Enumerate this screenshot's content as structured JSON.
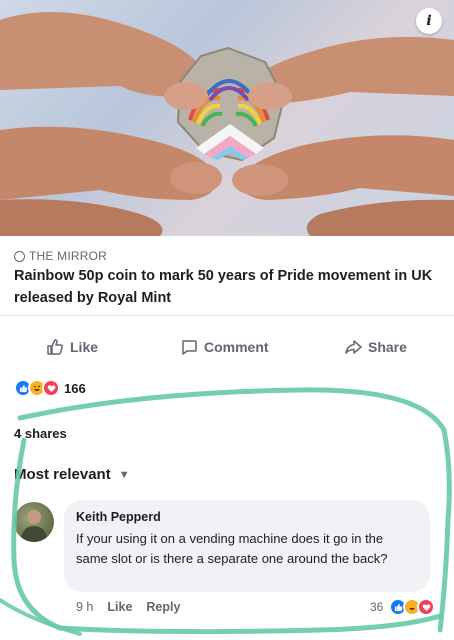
{
  "post": {
    "info_label": "i",
    "source": "THE MIRROR",
    "headline": "Rainbow 50p coin to mark 50 years of Pride movement in UK released by Royal Mint"
  },
  "actions": {
    "like": "Like",
    "comment": "Comment",
    "share": "Share"
  },
  "reactions": {
    "count": "166",
    "icons": [
      "like-icon",
      "haha-icon",
      "love-icon"
    ]
  },
  "shares": "4 shares",
  "sort": "Most relevant",
  "comment": {
    "author": "Keith Pepperd",
    "text": "If your using it on a vending machine does it go in the same slot or is there a separate one around the back?",
    "time": "9 h",
    "like": "Like",
    "reply": "Reply",
    "reaction_count": "36"
  },
  "colors": {
    "facebook_blue": "#1877f2",
    "love_red": "#f33e58",
    "haha_yellow": "#f7b125",
    "annotation_green": "#66c9a6"
  }
}
